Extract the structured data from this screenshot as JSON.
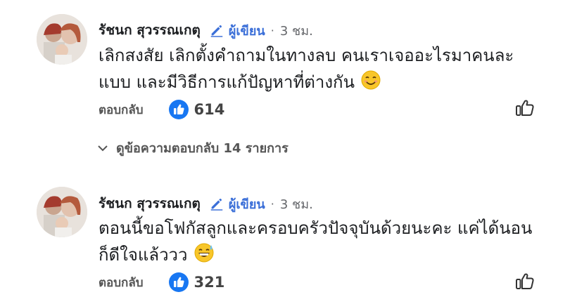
{
  "comments": [
    {
      "author": "รัชนก สุวรรณเกตุ",
      "badge_label": "ผู้เขียน",
      "time": "3 ชม.",
      "text": "เลิกสงสัย เลิกตั้งคำถามในทางลบ คนเราเจออะไรมาคนละแบบ และมีวิธีการแก้ปัญหาที่ต่างกัน",
      "emoji": "smiling-face",
      "reply_label": "ตอบกลับ",
      "like_count": "614"
    },
    {
      "author": "รัชนก สุวรรณเกตุ",
      "badge_label": "ผู้เขียน",
      "time": "3 ชม.",
      "text": "ตอนนี้ขอโฟกัสลูกและครอบครัวปัจจุบันด้วยนะคะ แค่ได้นอนก็ดีใจแล้ววว",
      "emoji": "grinning-sweat-face",
      "reply_label": "ตอบกลับ",
      "like_count": "321"
    }
  ],
  "view_replies": {
    "label": "ดูข้อความตอบกลับ 14 รายการ"
  },
  "colors": {
    "like_blue": "#1877f2",
    "author_badge": "#3b6fd8",
    "muted": "#65676b"
  }
}
